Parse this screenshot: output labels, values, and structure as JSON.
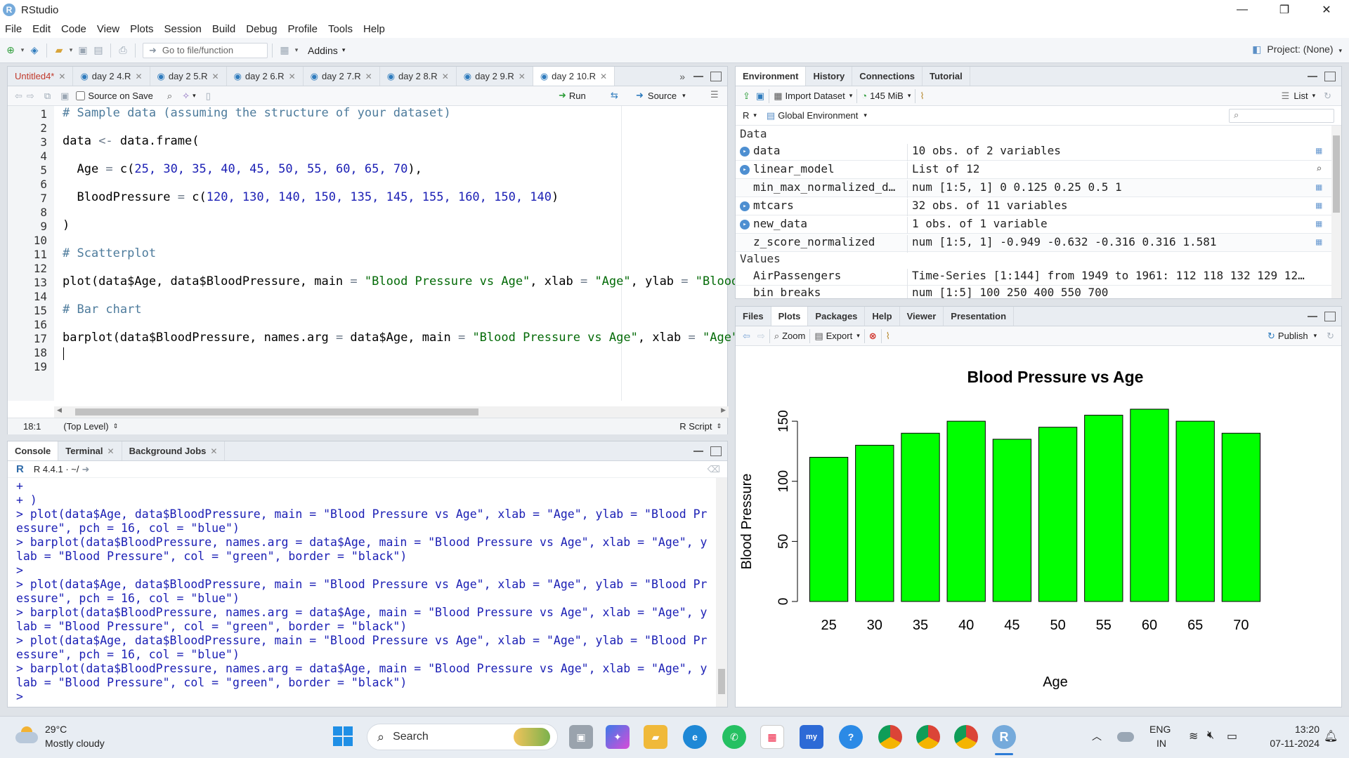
{
  "window": {
    "title": "RStudio",
    "logo_letter": "R",
    "min": "—",
    "restore": "❐",
    "close": "✕"
  },
  "menu": [
    "File",
    "Edit",
    "Code",
    "View",
    "Plots",
    "Session",
    "Build",
    "Debug",
    "Profile",
    "Tools",
    "Help"
  ],
  "toolbar": {
    "goto_placeholder": "Go to file/function",
    "addins": "Addins",
    "project": "Project: (None)"
  },
  "editor": {
    "tabs": [
      {
        "label": "Untitled4*",
        "active": false
      },
      {
        "label": "day 2 4.R",
        "active": false
      },
      {
        "label": "day 2 5.R",
        "active": false
      },
      {
        "label": "day 2 6.R",
        "active": false
      },
      {
        "label": "day 2 7.R",
        "active": false
      },
      {
        "label": "day 2 8.R",
        "active": false
      },
      {
        "label": "day 2 9.R",
        "active": false
      },
      {
        "label": "day 2 10.R",
        "active": true
      }
    ],
    "source_on_save": "Source on Save",
    "run": "Run",
    "source": "Source",
    "line_numbers": [
      "1",
      "2",
      "3",
      "4",
      "5",
      "6",
      "7",
      "8",
      "9",
      "10",
      "11",
      "12",
      "13",
      "14",
      "15",
      "16",
      "17",
      "18",
      "19"
    ],
    "status_pos": "18:1",
    "status_scope": "(Top Level)",
    "status_type": "R Script"
  },
  "code": {
    "l1": "# Sample data (assuming the structure of your dataset)",
    "l3a": "data",
    "l3b": " <- ",
    "l3c": "data.frame(",
    "l5a": "  Age ",
    "l5b": "= ",
    "l5c": "c(",
    "l5d": "25, 30, 35, 40, 45, 50, 55, 60, 65, 70",
    "l5e": "),",
    "l7a": "  BloodPressure ",
    "l7b": "= ",
    "l7c": "c(",
    "l7d": "120, 130, 140, 150, 135, 145, 155, 160, 150, 140",
    "l7e": ")",
    "l9": ")",
    "l11": "# Scatterplot",
    "l13a": "plot(data$Age, data$BloodPressure, main ",
    "l13b": "= ",
    "l13c": "\"Blood Pressure vs Age\"",
    "l13d": ", xlab ",
    "l13e": "= ",
    "l13f": "\"Age\"",
    "l13g": ", ylab ",
    "l13h": "= ",
    "l13i": "\"Blood P",
    "l15": "# Bar chart",
    "l17a": "barplot(data$BloodPressure, names.arg ",
    "l17b": "= ",
    "l17c": "data$Age, main ",
    "l17d": "= ",
    "l17e": "\"Blood Pressure vs Age\"",
    "l17f": ", xlab ",
    "l17g": "= ",
    "l17h": "\"Age\"",
    "l17i": ","
  },
  "console": {
    "tabs": [
      "Console",
      "Terminal",
      "Background Jobs"
    ],
    "r_version": "R 4.4.1 · ~/",
    "lines": [
      "+",
      "+ )",
      "> plot(data$Age, data$BloodPressure, main = \"Blood Pressure vs Age\", xlab = \"Age\", ylab = \"Blood Pr",
      "essure\", pch = 16, col = \"blue\")",
      "> barplot(data$BloodPressure, names.arg = data$Age, main = \"Blood Pressure vs Age\", xlab = \"Age\", y",
      "lab = \"Blood Pressure\", col = \"green\", border = \"black\")",
      ">",
      "> plot(data$Age, data$BloodPressure, main = \"Blood Pressure vs Age\", xlab = \"Age\", ylab = \"Blood Pr",
      "essure\", pch = 16, col = \"blue\")",
      "> barplot(data$BloodPressure, names.arg = data$Age, main = \"Blood Pressure vs Age\", xlab = \"Age\", y",
      "lab = \"Blood Pressure\", col = \"green\", border = \"black\")",
      "> plot(data$Age, data$BloodPressure, main = \"Blood Pressure vs Age\", xlab = \"Age\", ylab = \"Blood Pr",
      "essure\", pch = 16, col = \"blue\")",
      "> barplot(data$BloodPressure, names.arg = data$Age, main = \"Blood Pressure vs Age\", xlab = \"Age\", y",
      "lab = \"Blood Pressure\", col = \"green\", border = \"black\")",
      "> "
    ]
  },
  "environment": {
    "tabs": [
      "Environment",
      "History",
      "Connections",
      "Tutorial"
    ],
    "import_dataset": "Import Dataset",
    "memory": "145 MiB",
    "list_view": "List",
    "lang": "R",
    "scope": "Global Environment",
    "section_data": "Data",
    "section_values": "Values",
    "rows": [
      {
        "name": "data",
        "value": "10 obs. of 2 variables",
        "bullet": true
      },
      {
        "name": "linear_model",
        "value": "List of  12",
        "bullet": true
      },
      {
        "name": "min_max_normalized_d…",
        "value": "num [1:5, 1] 0 0.125 0.25 0.5 1",
        "bullet": false
      },
      {
        "name": "mtcars",
        "value": "32 obs. of 11 variables",
        "bullet": true
      },
      {
        "name": "new_data",
        "value": "1 obs. of 1 variable",
        "bullet": true
      },
      {
        "name": "z_score_normalized",
        "value": "num [1:5, 1] -0.949 -0.632 -0.316 0.316 1.581",
        "bullet": false
      }
    ],
    "values": [
      {
        "name": "AirPassengers",
        "value": "Time-Series [1:144] from 1949 to 1961: 112 118 132 129 12…"
      },
      {
        "name": "bin_breaks",
        "value": "num [1:5] 100 250 400 550 700"
      }
    ]
  },
  "files": {
    "tabs": [
      "Files",
      "Plots",
      "Packages",
      "Help",
      "Viewer",
      "Presentation"
    ],
    "zoom": "Zoom",
    "export": "Export",
    "publish": "Publish"
  },
  "chart_data": {
    "type": "bar",
    "title": "Blood Pressure vs Age",
    "xlabel": "Age",
    "ylabel": "Blood Pressure",
    "categories": [
      "25",
      "30",
      "35",
      "40",
      "45",
      "50",
      "55",
      "60",
      "65",
      "70"
    ],
    "values": [
      120,
      130,
      140,
      150,
      135,
      145,
      155,
      160,
      150,
      140
    ],
    "ylim": [
      0,
      160
    ],
    "yticks": [
      "0",
      "50",
      "100",
      "150"
    ],
    "bar_color": "#00ff00",
    "border_color": "#000000",
    "grid": false
  },
  "taskbar": {
    "weather_temp": "29°C",
    "weather_desc": "Mostly cloudy",
    "search": "Search",
    "lang1": "ENG",
    "lang2": "IN",
    "time": "13:20",
    "date": "07-11-2024"
  }
}
